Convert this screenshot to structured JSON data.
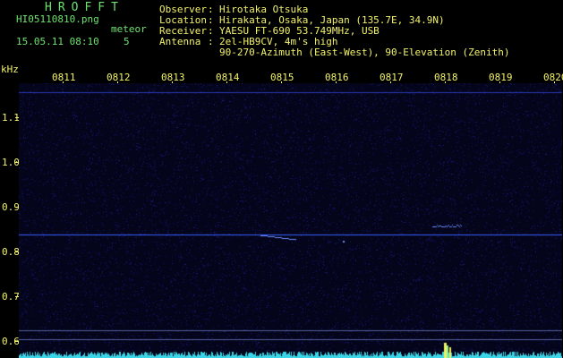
{
  "title": "HROFFT",
  "filename": "HI05110810.png",
  "datetime": "15.05.11 08:10",
  "meteor_label": "meteor",
  "meteor_count": "5",
  "info": {
    "observer_key": "Observer",
    "observer_val": "Hirotaka Otsuka",
    "location_key": "Location",
    "location_val": "Hirakata, Osaka, Japan (135.7E, 34.9N)",
    "receiver_key": "Receiver",
    "receiver_val": "YAESU FT-690 53.749MHz, USB",
    "antenna_key": "Antenna",
    "antenna_val": "2el-HB9CV, 4m's high",
    "antenna_val2": "90-270-Azimuth (East-West), 90-Elevation (Zenith)"
  },
  "y_unit": "kHz",
  "x_ticks": [
    "0811",
    "0812",
    "0813",
    "0814",
    "0815",
    "0816",
    "0817",
    "0818",
    "0819",
    "0820"
  ],
  "y_ticks": [
    "1.1",
    "1.0",
    "0.9",
    "0.8",
    "0.7",
    "0.6"
  ],
  "colors": {
    "accent_green": "#6fe36f",
    "accent_yellow": "#f2f26a",
    "signal": "#3a5cff"
  }
}
